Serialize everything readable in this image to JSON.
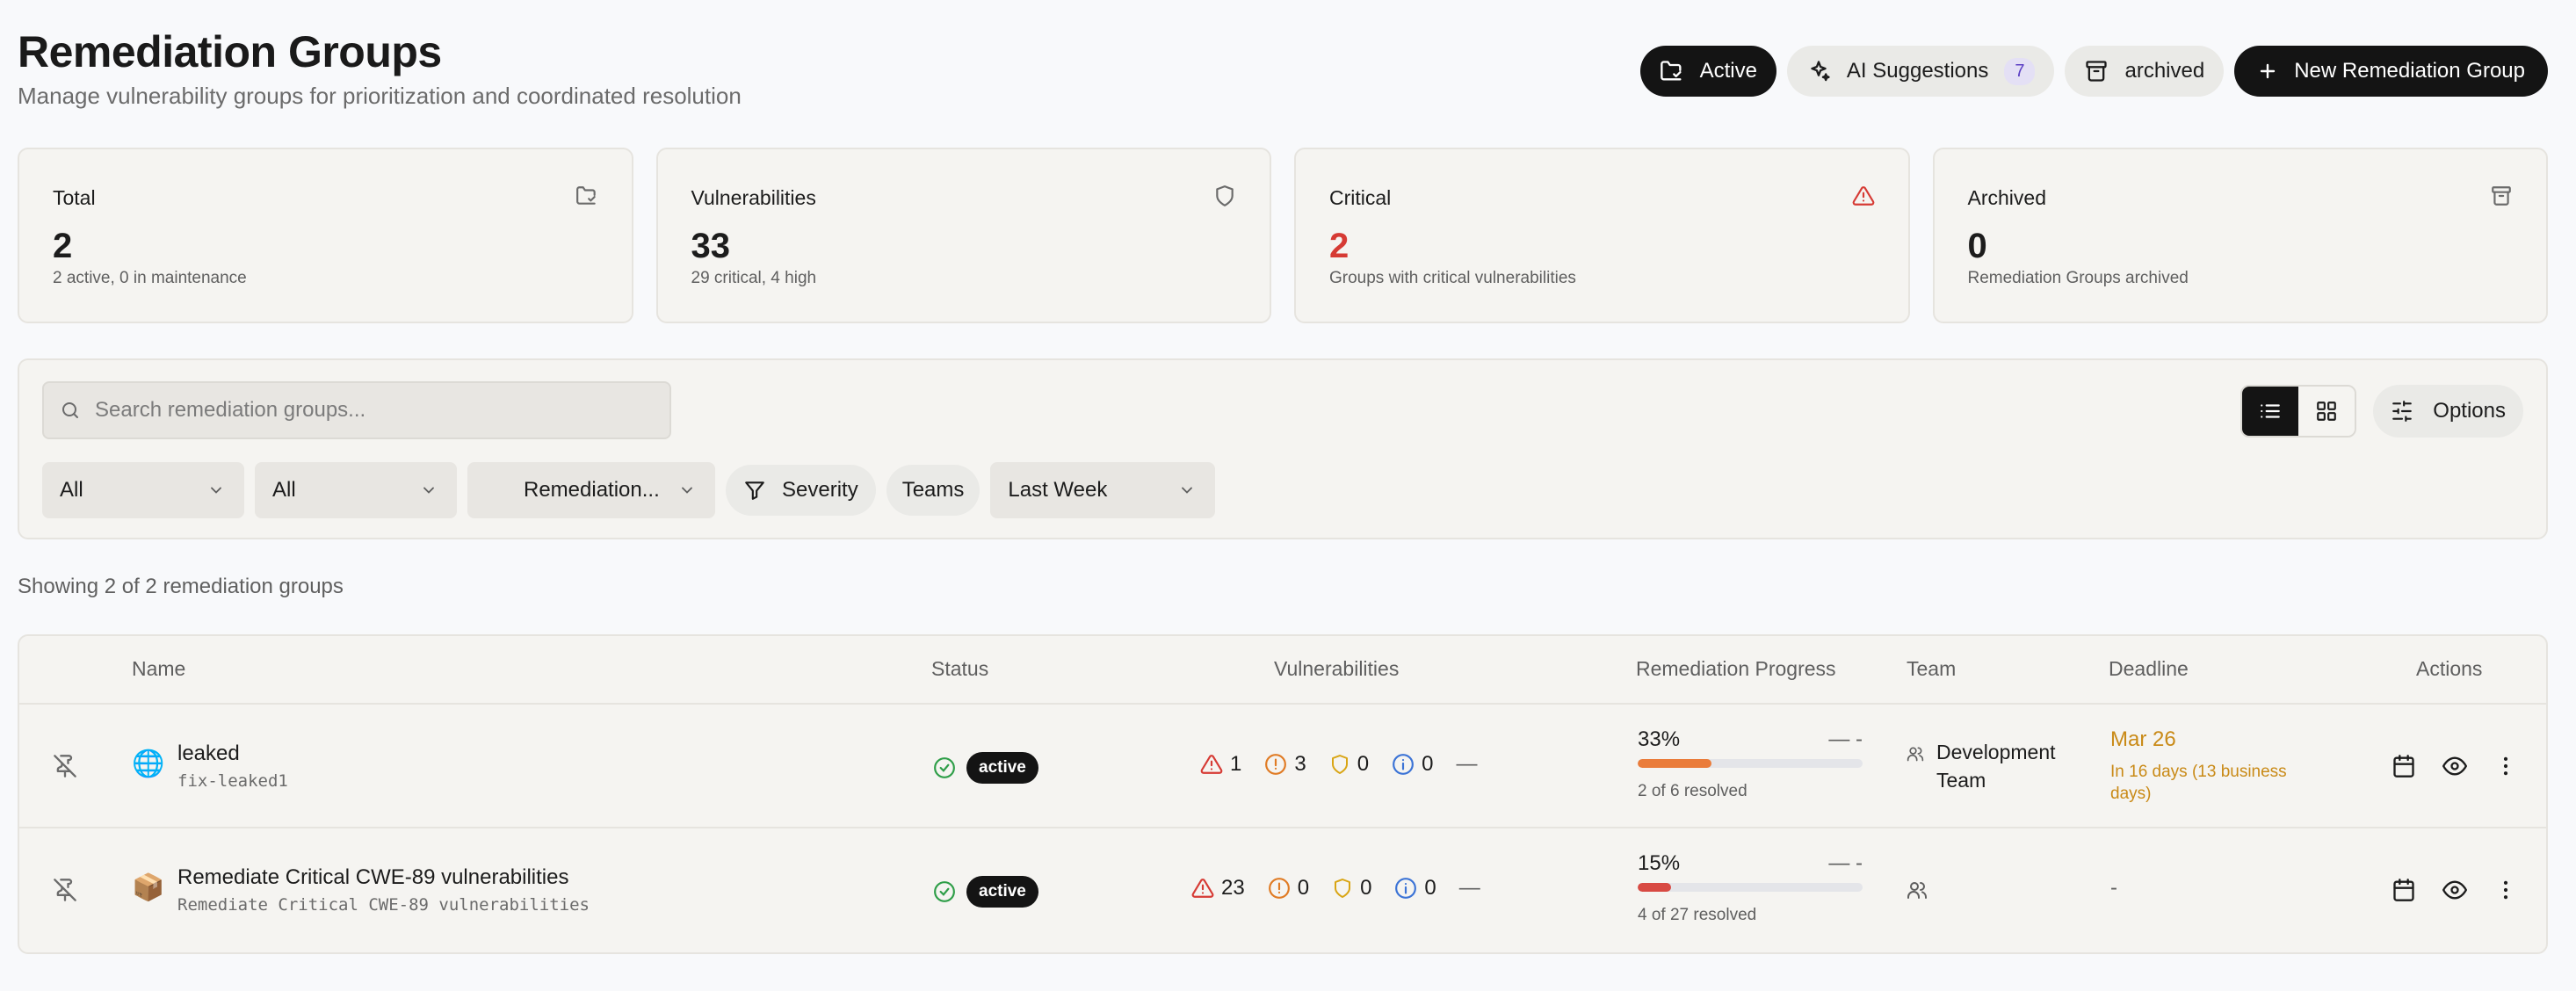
{
  "header": {
    "title": "Remediation Groups",
    "subtitle": "Manage vulnerability groups for prioritization and coordinated resolution",
    "active_label": "Active",
    "ai_label": "AI Suggestions",
    "ai_count": "7",
    "archived_label": "archived",
    "new_label": "New Remediation Group"
  },
  "stats": [
    {
      "title": "Total",
      "value": "2",
      "sub": "2 active, 0 in maintenance",
      "icon": "folder-icon"
    },
    {
      "title": "Vulnerabilities",
      "value": "33",
      "sub": "29 critical, 4 high",
      "icon": "shield-icon"
    },
    {
      "title": "Critical",
      "value": "2",
      "sub": "Groups with critical vulnerabilities",
      "icon": "alert-triangle-icon"
    },
    {
      "title": "Archived",
      "value": "0",
      "sub": "Remediation Groups archived",
      "icon": "archive-icon"
    }
  ],
  "filters": {
    "search_placeholder": "Search remediation groups...",
    "select1": "All",
    "select2": "All",
    "select3": "Remediation...",
    "severity": "Severity",
    "teams": "Teams",
    "period": "Last Week",
    "options": "Options"
  },
  "showing": "Showing 2 of 2 remediation groups",
  "table": {
    "headers": {
      "name": "Name",
      "status": "Status",
      "vulnerabilities": "Vulnerabilities",
      "progress": "Remediation Progress",
      "team": "Team",
      "deadline": "Deadline",
      "actions": "Actions"
    },
    "rows": [
      {
        "emoji": "🌐",
        "name": "leaked",
        "slug": "fix-leaked1",
        "status": "active",
        "critical": "1",
        "high": "3",
        "medium": "0",
        "low": "0",
        "dash": "—",
        "percent": "33%",
        "progress": 0.33,
        "trend": "— -",
        "resolved": "2 of 6 resolved",
        "team": "Development Team",
        "deadline": "Mar 26",
        "deadline_note": "In 16 days (13 business days)"
      },
      {
        "emoji": "📦",
        "name": "Remediate Critical CWE-89 vulnerabilities",
        "slug": "Remediate Critical CWE-89 vulnerabilities",
        "status": "active",
        "critical": "23",
        "high": "0",
        "medium": "0",
        "low": "0",
        "dash": "—",
        "percent": "15%",
        "progress": 0.15,
        "trend": "— -",
        "resolved": "4 of 27 resolved",
        "team": "",
        "deadline": "-",
        "deadline_note": ""
      }
    ]
  },
  "colors": {
    "critical": "#d63a34",
    "high": "#e07b24",
    "medium": "#d9a514",
    "low": "#3b73d6",
    "success": "#2e9e48",
    "progress_orange": "#ea7c3a",
    "progress_red": "#d84a43",
    "deadline": "#c98a17"
  }
}
